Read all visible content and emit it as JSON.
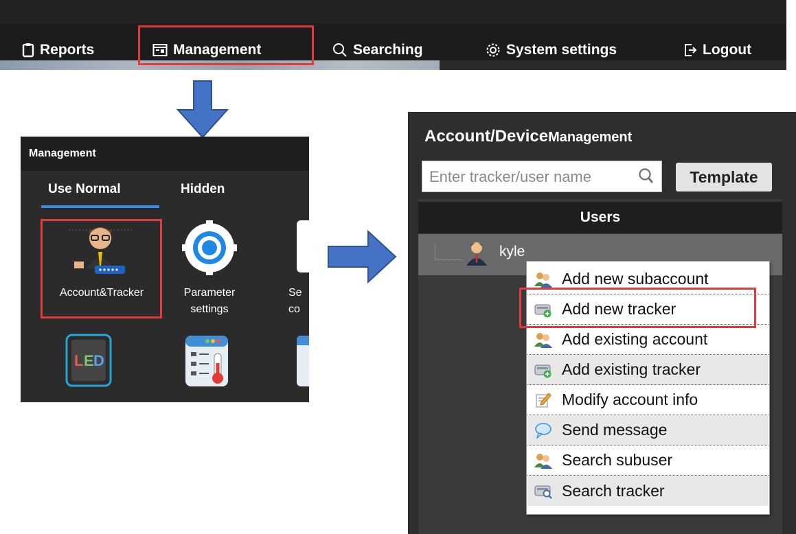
{
  "nav": {
    "items": [
      {
        "label": "Reports",
        "icon": "clipboard-icon"
      },
      {
        "label": "Management",
        "icon": "management-icon"
      },
      {
        "label": "Searching",
        "icon": "search-icon"
      },
      {
        "label": "System settings",
        "icon": "gear-icon"
      },
      {
        "label": "Logout",
        "icon": "logout-icon"
      }
    ]
  },
  "management_panel": {
    "title": "Management",
    "tabs": [
      {
        "label": "Use Normal",
        "active": true
      },
      {
        "label": "Hidden",
        "active": false
      }
    ],
    "tiles": [
      {
        "label": "Account&Tracker",
        "icon": "account-tracker-icon"
      },
      {
        "label": "Parameter settings",
        "icon": "parameter-gear-icon"
      },
      {
        "label": "Se co",
        "icon": "partial-tile-icon"
      },
      {
        "label": "",
        "icon": "led-icon"
      },
      {
        "label": "",
        "icon": "thermometer-icon"
      },
      {
        "label": "",
        "icon": "partial-tile-icon"
      }
    ]
  },
  "account_panel": {
    "title_main": "Account/Device",
    "title_sub": "Management",
    "search_placeholder": "Enter tracker/user name",
    "template_label": "Template",
    "users_header": "Users",
    "user": {
      "name": "kyle",
      "icon": "user-icon"
    }
  },
  "context_menu": {
    "items": [
      {
        "label": "Add new subaccount",
        "icon": "users-icon"
      },
      {
        "label": "Add new tracker",
        "icon": "tracker-add-icon"
      },
      {
        "label": "Add existing account",
        "icon": "users-icon"
      },
      {
        "label": "Add existing tracker",
        "icon": "tracker-add-icon"
      },
      {
        "label": "Modify account info",
        "icon": "edit-icon"
      },
      {
        "label": "Send message",
        "icon": "message-icon"
      },
      {
        "label": "Search subuser",
        "icon": "users-icon"
      },
      {
        "label": "Search tracker",
        "icon": "tracker-search-icon"
      }
    ]
  },
  "colors": {
    "highlight": "#e23b3b",
    "arrow": "#4472c4",
    "tab_underline": "#2e8be6",
    "panel_dark": "#2b2b2b"
  }
}
